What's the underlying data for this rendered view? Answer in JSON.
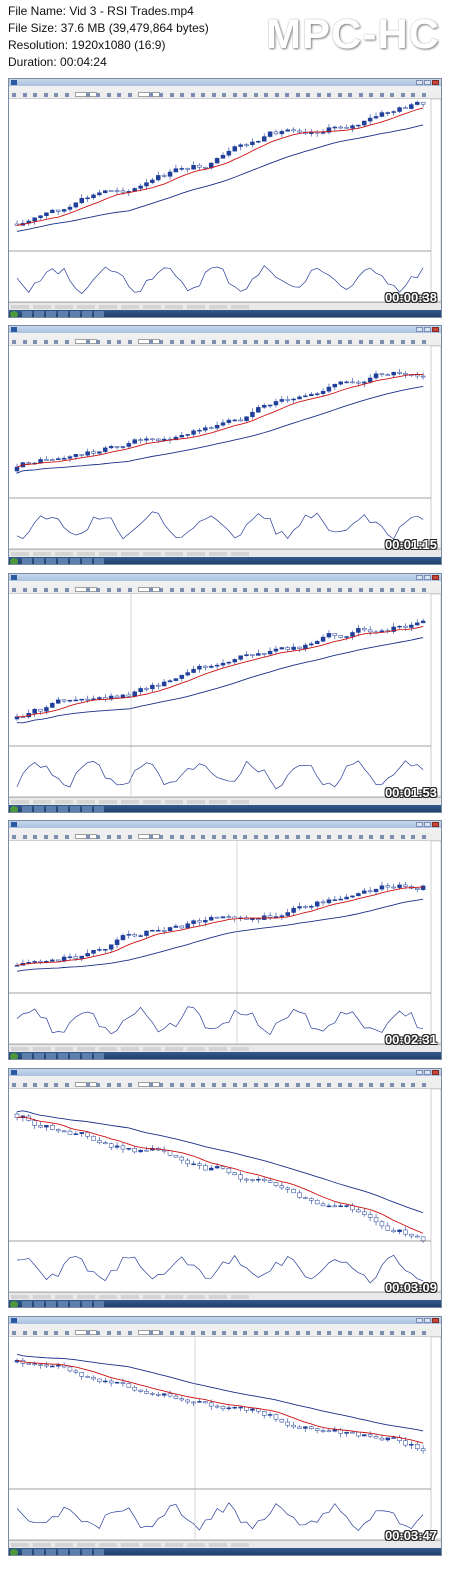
{
  "header": {
    "file_name": "File Name: Vid 3 - RSI Trades.mp4",
    "file_size": "File Size: 37.6 MB (39,479,864 bytes)",
    "resolution": "Resolution: 1920x1080 (16:9)",
    "duration": "Duration: 00:04:24",
    "logo": "MPC-HC"
  },
  "frames": [
    {
      "timestamp": "00:00:38",
      "trend": "up"
    },
    {
      "timestamp": "00:01:15",
      "trend": "up"
    },
    {
      "timestamp": "00:01:53",
      "trend": "up"
    },
    {
      "timestamp": "00:02:31",
      "trend": "up"
    },
    {
      "timestamp": "00:03:09",
      "trend": "down"
    },
    {
      "timestamp": "00:03:47",
      "trend": "down"
    }
  ],
  "colors": {
    "bull_candle": "#1f3f9a",
    "bear_candle": "#ffffff",
    "fast_ma": "#cc1111",
    "slow_ma": "#1a2f8a",
    "rsi_line": "#2a3f9a"
  }
}
